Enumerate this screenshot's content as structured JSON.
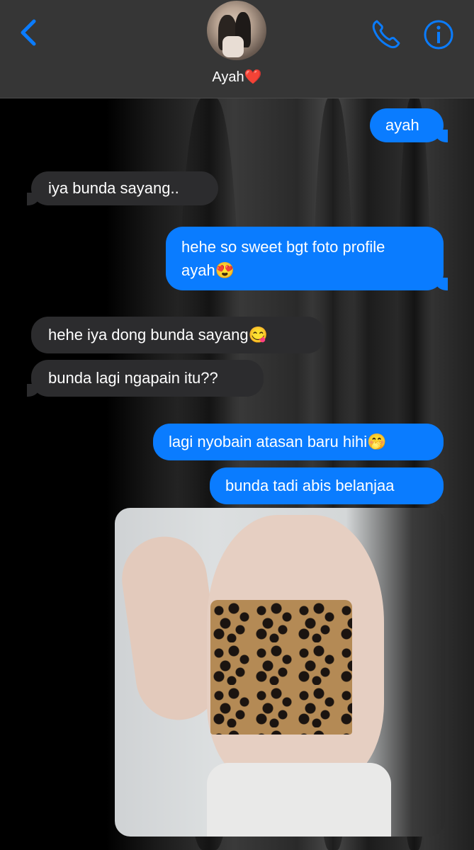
{
  "header": {
    "contact_name": "Ayah",
    "heart": "❤️",
    "back_icon": "chevron-left-icon",
    "call_icon": "phone-icon",
    "info_icon": "info-icon",
    "accent_color": "#0a7cff"
  },
  "messages": [
    {
      "side": "out",
      "text": "ayah"
    },
    {
      "side": "in",
      "text": "iya bunda sayang.."
    },
    {
      "side": "out",
      "text": "hehe so sweet bgt foto profile",
      "text2": "ayah",
      "emoji": "😍"
    },
    {
      "side": "in",
      "text": "hehe iya dong bunda sayang",
      "emoji": "😋"
    },
    {
      "side": "in",
      "text": "bunda lagi ngapain itu??"
    },
    {
      "side": "out",
      "text": "lagi nyobain atasan baru hihi",
      "emoji": "🤭"
    },
    {
      "side": "out",
      "text": "bunda tadi abis belanjaa"
    },
    {
      "side": "out",
      "type": "photo"
    }
  ]
}
